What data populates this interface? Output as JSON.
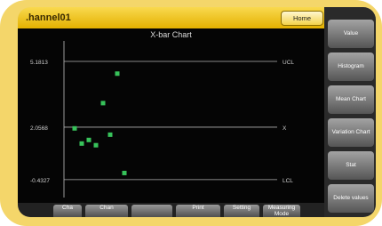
{
  "window": {
    "title": ".hannel01",
    "home_label": "Home"
  },
  "chart_data": {
    "type": "scatter",
    "title": "X-bar Chart",
    "y_tick_labels": [
      "5.1813",
      "2.0568",
      "-0.4327"
    ],
    "right_labels": [
      "UCL",
      "X",
      "LCL"
    ],
    "ucl": 5.1813,
    "center": 2.0568,
    "lcl": -0.4327,
    "ylim": [
      -1.2,
      5.9
    ],
    "x": [
      1,
      2,
      3,
      4,
      5,
      6,
      7,
      8
    ],
    "values": [
      2.0,
      1.28,
      1.45,
      1.2,
      3.2,
      1.7,
      4.6,
      -0.12
    ],
    "color": "#37c25a"
  },
  "sidebar": {
    "buttons": [
      {
        "label": "Value"
      },
      {
        "label": "Histogram"
      },
      {
        "label": "Mean Chart"
      },
      {
        "label": "Variation Chart"
      },
      {
        "label": "Stat"
      },
      {
        "label": "Delete values"
      }
    ]
  },
  "bottom": {
    "buttons": [
      {
        "label": "Cha"
      },
      {
        "label": "Chan"
      },
      {
        "label": ""
      },
      {
        "label": "Print"
      },
      {
        "label": "Setting"
      },
      {
        "label": "Measuring Mode"
      }
    ]
  },
  "colors": {
    "accent": "#f2c200",
    "chart_bg": "#050505",
    "point": "#37c25a"
  }
}
